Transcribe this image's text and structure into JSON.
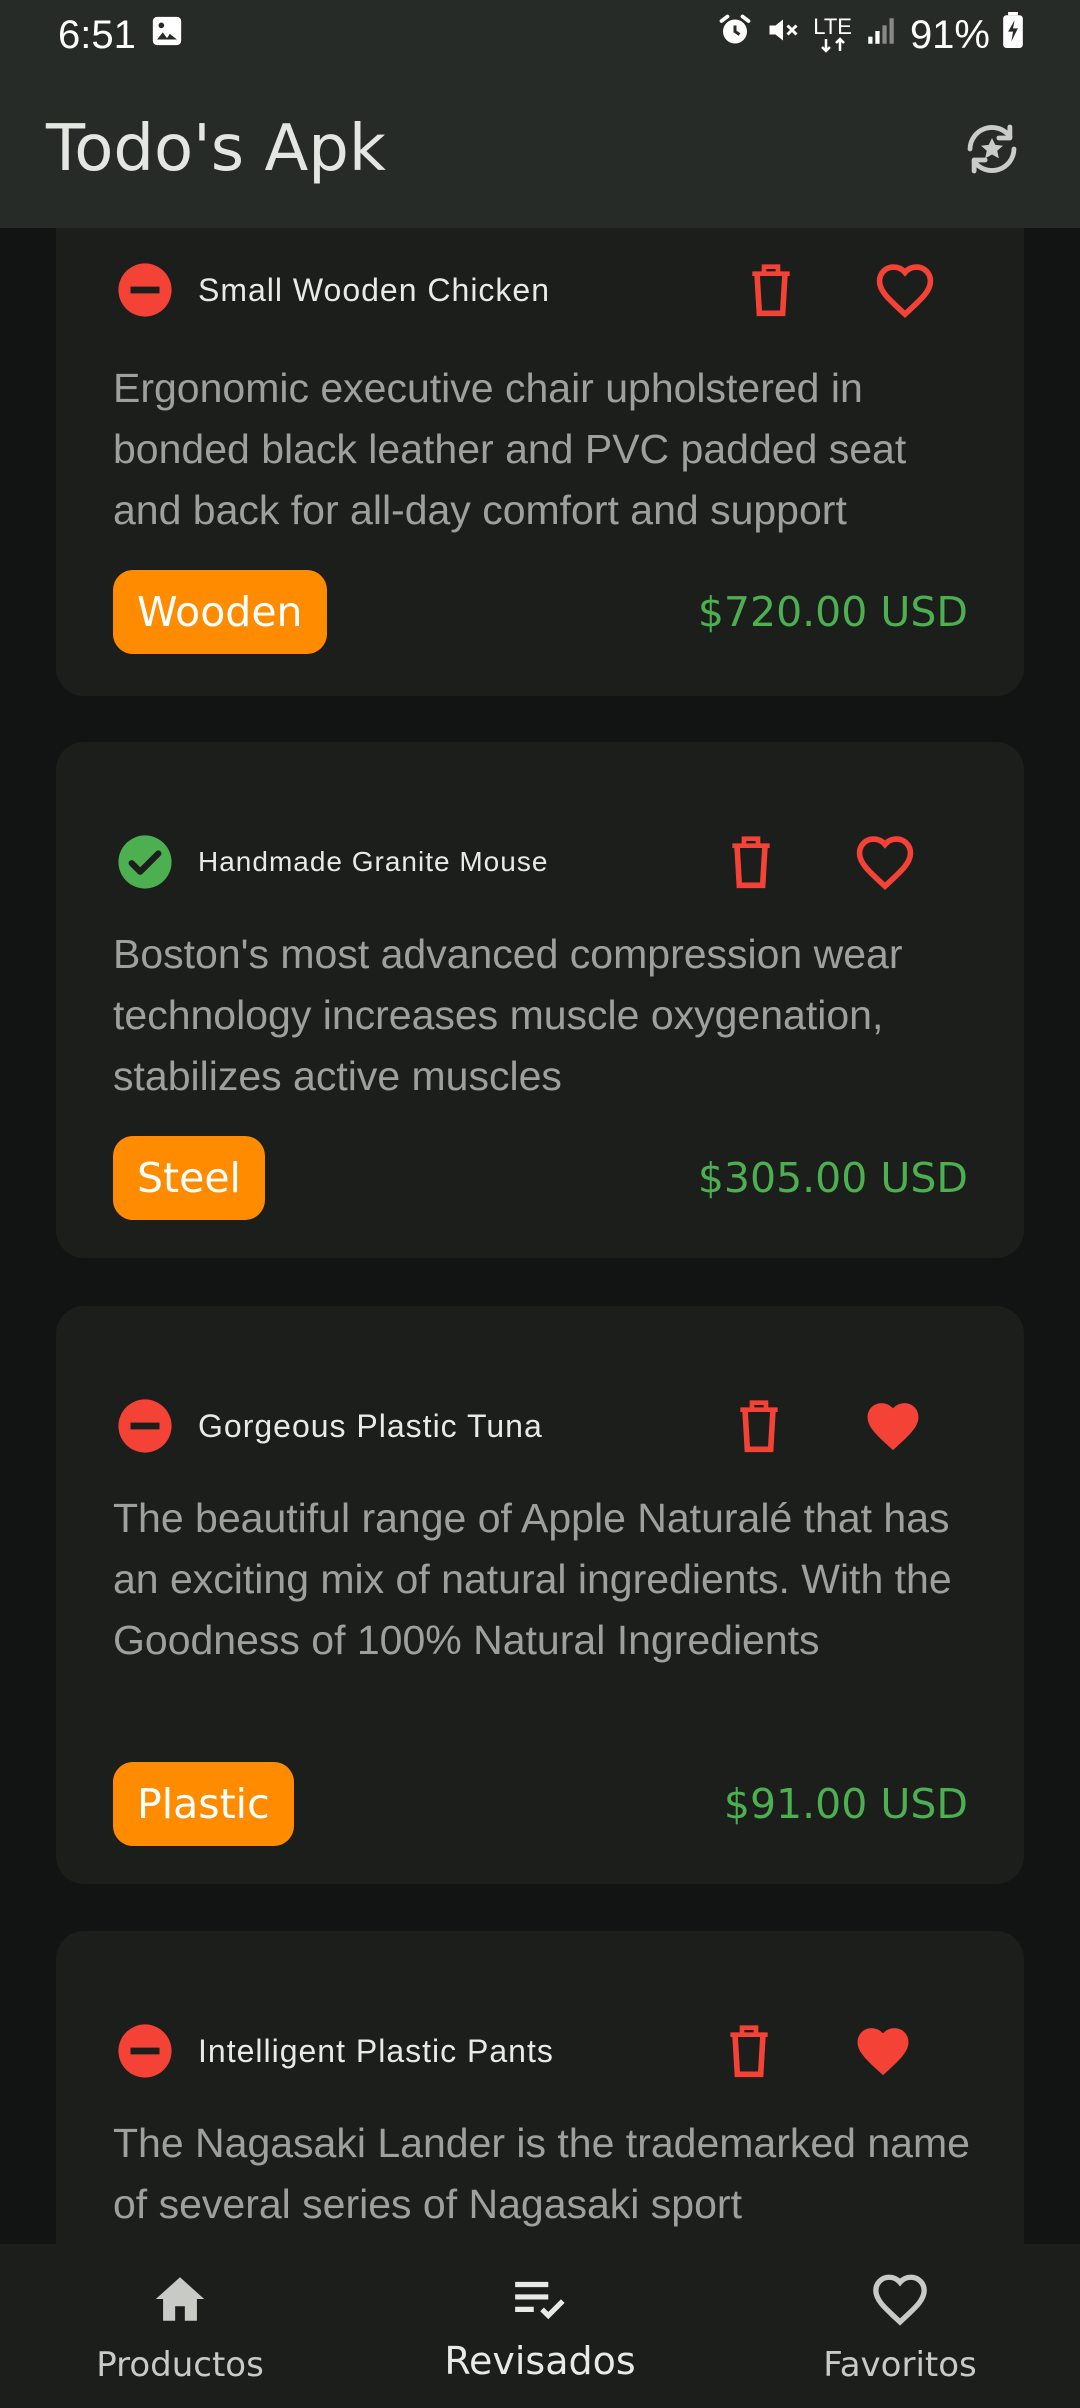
{
  "status_bar": {
    "time": "6:51",
    "network": "LTE",
    "battery": "91%",
    "icons": [
      "image-icon",
      "alarm-icon",
      "mute-icon",
      "lte-icon",
      "signal-icon",
      "battery-icon"
    ]
  },
  "app_bar": {
    "title": "Todo's Apk",
    "action_icon": "refresh-icon"
  },
  "colors": {
    "primary_text": "#e4e6e1",
    "accent_red": "#f44336",
    "accent_green": "#4caf50",
    "tag_orange": "#ff8c00",
    "card_bg": "#1c1e1c",
    "background": "#111412"
  },
  "products": [
    {
      "name": "Small Wooden Chicken",
      "status": "pending",
      "status_icon": "remove-circle-icon",
      "description": "Ergonomic executive chair upholstered in bonded black leather and PVC padded seat and back for all-day comfort and support",
      "material": "Wooden",
      "price": "$720.00 USD",
      "favorite": false
    },
    {
      "name": "Handmade Granite Mouse",
      "status": "reviewed",
      "status_icon": "check-circle-icon",
      "description": "Boston's most advanced compression wear technology increases muscle oxygenation, stabilizes active muscles",
      "material": "Steel",
      "price": "$305.00 USD",
      "favorite": false
    },
    {
      "name": "Gorgeous Plastic Tuna",
      "status": "pending",
      "status_icon": "remove-circle-icon",
      "description": "The beautiful range of Apple Naturalé that has an exciting mix of natural ingredients. With the Goodness of 100% Natural Ingredients",
      "material": "Plastic",
      "price": "$91.00 USD",
      "favorite": true
    },
    {
      "name": "Intelligent Plastic Pants",
      "status": "pending",
      "status_icon": "remove-circle-icon",
      "description": "The Nagasaki Lander is the trademarked name of several series of Nagasaki sport",
      "material": "",
      "price": "",
      "favorite": true
    }
  ],
  "nav": {
    "items": [
      {
        "label": "Productos",
        "icon": "home-icon",
        "active": false
      },
      {
        "label": "Revisados",
        "icon": "checklist-icon",
        "active": true
      },
      {
        "label": "Favoritos",
        "icon": "heart-outline-icon",
        "active": false
      }
    ]
  }
}
